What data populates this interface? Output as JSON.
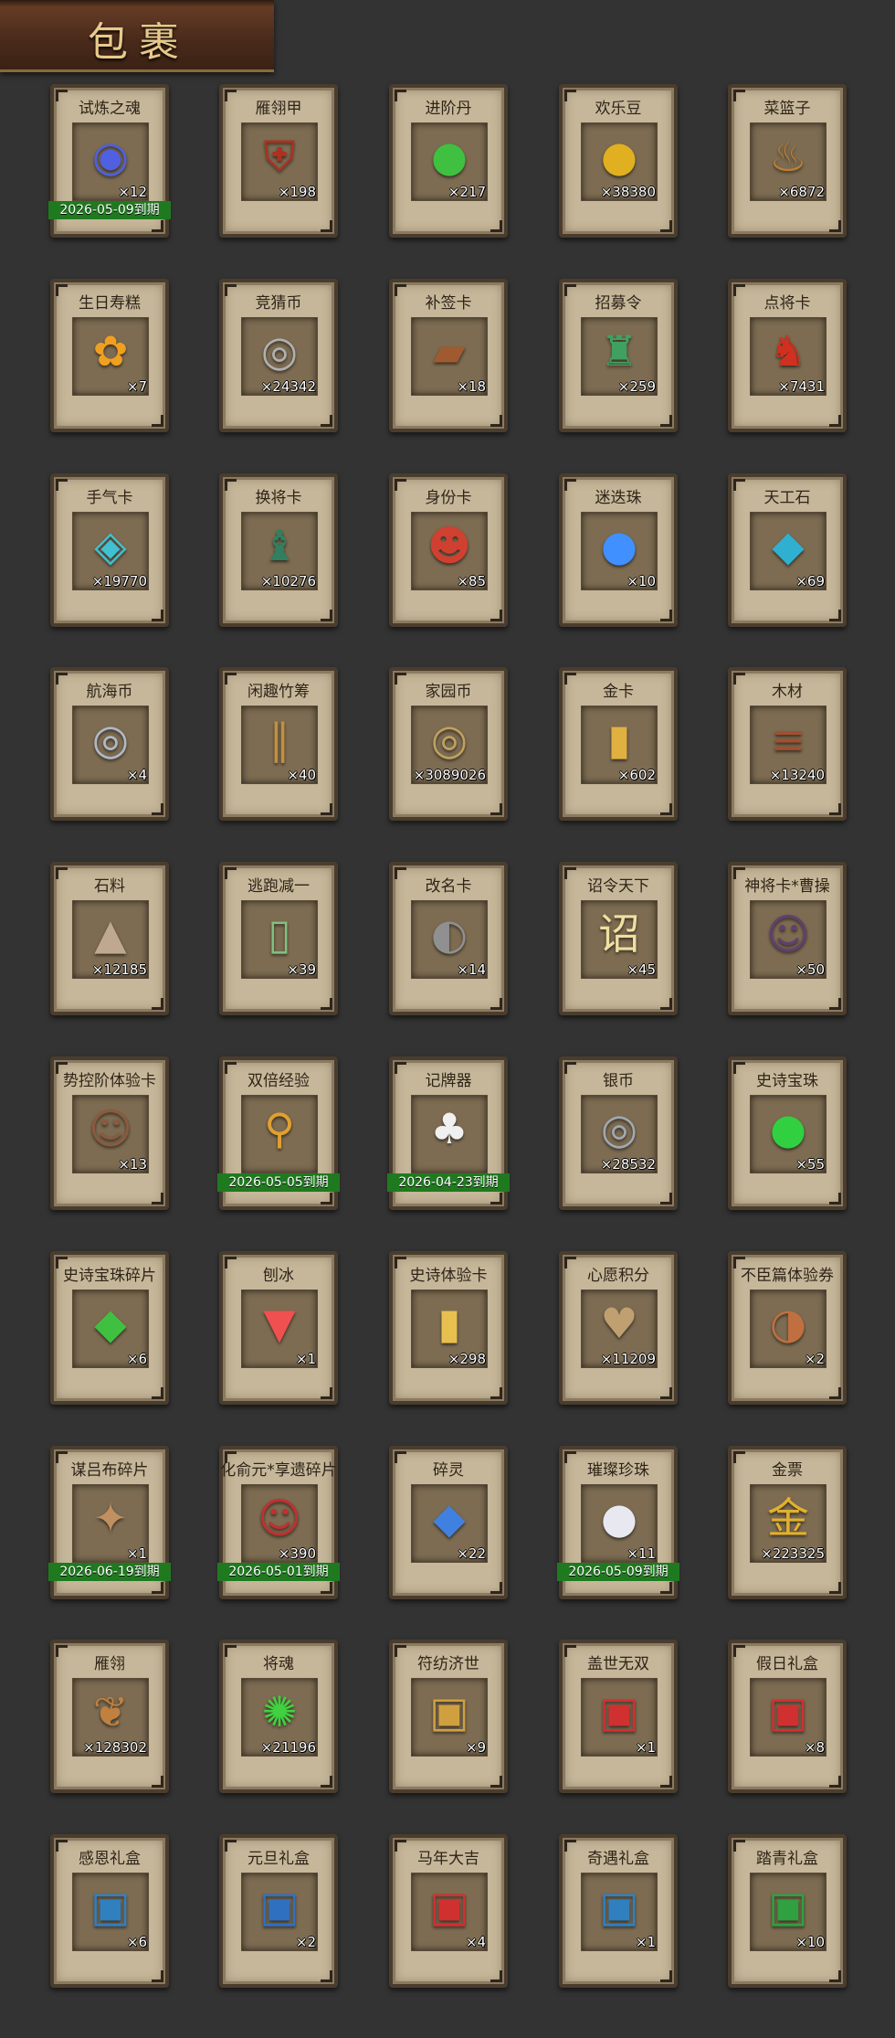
{
  "header": {
    "title": "包裹"
  },
  "items": [
    {
      "name": "试炼之魂",
      "count": "×12",
      "icon": "soul-orb",
      "glyph": "◉",
      "color": "#5060e0",
      "expiry": "2026-05-09到期"
    },
    {
      "name": "雁翎甲",
      "count": "×198",
      "icon": "armor",
      "glyph": "⛨",
      "color": "#b03020",
      "expiry": ""
    },
    {
      "name": "进阶丹",
      "count": "×217",
      "icon": "pill",
      "glyph": "●",
      "color": "#40c040",
      "expiry": ""
    },
    {
      "name": "欢乐豆",
      "count": "×38380",
      "icon": "beans",
      "glyph": "●",
      "color": "#e0b020",
      "expiry": ""
    },
    {
      "name": "菜篮子",
      "count": "×6872",
      "icon": "basket",
      "glyph": "♨",
      "color": "#c08030",
      "expiry": ""
    },
    {
      "name": "生日寿糕",
      "count": "×7",
      "icon": "cake",
      "glyph": "✿",
      "color": "#f0a020",
      "expiry": ""
    },
    {
      "name": "竞猜币",
      "count": "×24342",
      "icon": "coin",
      "glyph": "◎",
      "color": "#b0b0b0",
      "expiry": ""
    },
    {
      "name": "补签卡",
      "count": "×18",
      "icon": "card",
      "glyph": "▰",
      "color": "#a05a30",
      "expiry": ""
    },
    {
      "name": "招募令",
      "count": "×259",
      "icon": "recruit-token",
      "glyph": "♜",
      "color": "#40a060",
      "expiry": ""
    },
    {
      "name": "点将卡",
      "count": "×7431",
      "icon": "general-card",
      "glyph": "♞",
      "color": "#d03020",
      "expiry": ""
    },
    {
      "name": "手气卡",
      "count": "×19770",
      "icon": "luck-card",
      "glyph": "◈",
      "color": "#40c0d0",
      "expiry": ""
    },
    {
      "name": "换将卡",
      "count": "×10276",
      "icon": "swap-card",
      "glyph": "♝",
      "color": "#308060",
      "expiry": ""
    },
    {
      "name": "身份卡",
      "count": "×85",
      "icon": "identity-card",
      "glyph": "☻",
      "color": "#d04030",
      "expiry": ""
    },
    {
      "name": "迷迭珠",
      "count": "×10",
      "icon": "pearl",
      "glyph": "●",
      "color": "#4090ff",
      "expiry": ""
    },
    {
      "name": "天工石",
      "count": "×69",
      "icon": "crystal",
      "glyph": "◆",
      "color": "#30b0d0",
      "expiry": ""
    },
    {
      "name": "航海币",
      "count": "×4",
      "icon": "coin",
      "glyph": "◎",
      "color": "#b0b8c8",
      "expiry": ""
    },
    {
      "name": "闲趣竹筹",
      "count": "×40",
      "icon": "bamboo-sticks",
      "glyph": "∥",
      "color": "#c09040",
      "expiry": ""
    },
    {
      "name": "家园币",
      "count": "×3089026",
      "icon": "coin",
      "glyph": "◎",
      "color": "#c0a060",
      "expiry": ""
    },
    {
      "name": "金卡",
      "count": "×602",
      "icon": "gold-card",
      "glyph": "▮",
      "color": "#e0b040",
      "expiry": ""
    },
    {
      "name": "木材",
      "count": "×13240",
      "icon": "wood",
      "glyph": "≡",
      "color": "#a05030",
      "expiry": ""
    },
    {
      "name": "石料",
      "count": "×12185",
      "icon": "stone",
      "glyph": "▲",
      "color": "#c0a890",
      "expiry": ""
    },
    {
      "name": "逃跑减一",
      "count": "×39",
      "icon": "talisman",
      "glyph": "▯",
      "color": "#80c080",
      "expiry": ""
    },
    {
      "name": "改名卡",
      "count": "×14",
      "icon": "rename-card",
      "glyph": "◐",
      "color": "#909090",
      "expiry": ""
    },
    {
      "name": "诏令天下",
      "count": "×45",
      "icon": "edict-scroll",
      "glyph": "诏",
      "color": "#f0e0a0",
      "expiry": ""
    },
    {
      "name": "神将卡*曹操",
      "count": "×50",
      "icon": "portrait",
      "glyph": "☺",
      "color": "#604070",
      "expiry": ""
    },
    {
      "name": "势控阶体验卡",
      "count": "×13",
      "icon": "portrait",
      "glyph": "☺",
      "color": "#8a5a40",
      "expiry": ""
    },
    {
      "name": "双倍经验",
      "count": "",
      "icon": "ruyi",
      "glyph": "⚲",
      "color": "#e0a030",
      "expiry": "2026-05-05到期"
    },
    {
      "name": "记牌器",
      "count": "",
      "icon": "cards",
      "glyph": "♣",
      "color": "#f0f0f0",
      "expiry": "2026-04-23到期"
    },
    {
      "name": "银币",
      "count": "×28532",
      "icon": "coin",
      "glyph": "◎",
      "color": "#a0a8b0",
      "expiry": ""
    },
    {
      "name": "史诗宝珠",
      "count": "×55",
      "icon": "orb",
      "glyph": "●",
      "color": "#30d040",
      "expiry": ""
    },
    {
      "name": "史诗宝珠碎片",
      "count": "×6",
      "icon": "shard",
      "glyph": "◆",
      "color": "#40c040",
      "expiry": ""
    },
    {
      "name": "刨冰",
      "count": "×1",
      "icon": "shaved-ice",
      "glyph": "▼",
      "color": "#f05050",
      "expiry": ""
    },
    {
      "name": "史诗体验卡",
      "count": "×298",
      "icon": "gold-card",
      "glyph": "▮",
      "color": "#e8c050",
      "expiry": ""
    },
    {
      "name": "心愿积分",
      "count": "×11209",
      "icon": "heart-coin",
      "glyph": "♥",
      "color": "#c0a070",
      "expiry": ""
    },
    {
      "name": "不臣篇体验券",
      "count": "×2",
      "icon": "ticket",
      "glyph": "◑",
      "color": "#c07040",
      "expiry": ""
    },
    {
      "name": "谋吕布碎片",
      "count": "×1",
      "icon": "puzzle",
      "glyph": "✦",
      "color": "#c09060",
      "expiry": "2026-06-19到期"
    },
    {
      "name": "化俞元*享遗碎片",
      "count": "×390",
      "icon": "portrait",
      "glyph": "☺",
      "color": "#c03030",
      "expiry": "2026-05-01到期"
    },
    {
      "name": "碎灵",
      "count": "×22",
      "icon": "crystal-shard",
      "glyph": "◆",
      "color": "#4080e0",
      "expiry": ""
    },
    {
      "name": "璀璨珍珠",
      "count": "×11",
      "icon": "pearl",
      "glyph": "●",
      "color": "#e8e8f0",
      "expiry": "2026-05-09到期"
    },
    {
      "name": "金票",
      "count": "×223325",
      "icon": "gold-ticket",
      "glyph": "金",
      "color": "#e0b030",
      "expiry": ""
    },
    {
      "name": "雁翎",
      "count": "×128302",
      "icon": "feather",
      "glyph": "❦",
      "color": "#c08040",
      "expiry": ""
    },
    {
      "name": "将魂",
      "count": "×21196",
      "icon": "soul",
      "glyph": "✺",
      "color": "#40d040",
      "expiry": ""
    },
    {
      "name": "符纺济世",
      "count": "×9",
      "icon": "gift-box",
      "glyph": "▣",
      "color": "#d0a040",
      "expiry": ""
    },
    {
      "name": "盖世无双",
      "count": "×1",
      "icon": "gift-box",
      "glyph": "▣",
      "color": "#d03030",
      "expiry": ""
    },
    {
      "name": "假日礼盒",
      "count": "×8",
      "icon": "gift-box",
      "glyph": "▣",
      "color": "#d03030",
      "expiry": ""
    },
    {
      "name": "感恩礼盒",
      "count": "×6",
      "icon": "gift-box",
      "glyph": "▣",
      "color": "#3080c0",
      "expiry": ""
    },
    {
      "name": "元旦礼盒",
      "count": "×2",
      "icon": "gift-box",
      "glyph": "▣",
      "color": "#3070c0",
      "expiry": ""
    },
    {
      "name": "马年大吉",
      "count": "×4",
      "icon": "gift-box",
      "glyph": "▣",
      "color": "#d03030",
      "expiry": ""
    },
    {
      "name": "奇遇礼盒",
      "count": "×1",
      "icon": "gift-box",
      "glyph": "▣",
      "color": "#3080c0",
      "expiry": ""
    },
    {
      "name": "踏青礼盒",
      "count": "×10",
      "icon": "gift-box",
      "glyph": "▣",
      "color": "#30a040",
      "expiry": ""
    }
  ]
}
